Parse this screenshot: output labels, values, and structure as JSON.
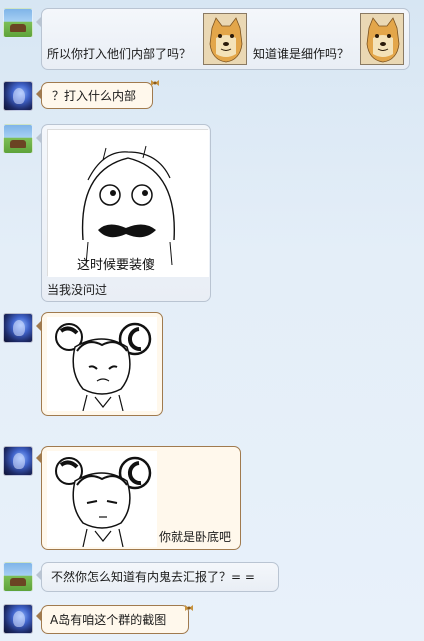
{
  "messages": [
    {
      "sender": "A",
      "text_1": "所以你打入他们内部了吗？",
      "text_2": "知道谁是细作吗？"
    },
    {
      "sender": "B",
      "text": "？打入什么内部"
    },
    {
      "sender": "A",
      "sticker_caption": "这时候要装傻",
      "text": "当我没问过"
    },
    {
      "sender": "B"
    },
    {
      "sender": "B",
      "text": "你就是卧底吧"
    },
    {
      "sender": "A",
      "text": "不然你怎么知道有内鬼去汇报了？= ="
    },
    {
      "sender": "B",
      "text": "A岛有咱这个群的截图"
    }
  ]
}
